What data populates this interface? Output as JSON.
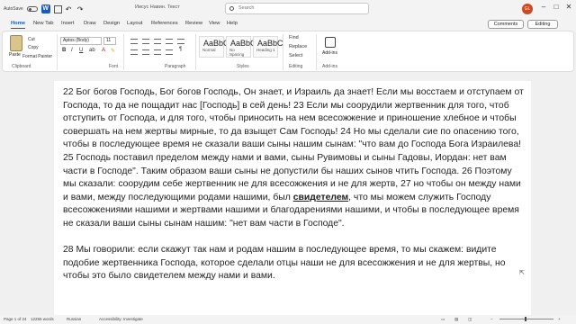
{
  "titlebar": {
    "autosave_label": "AutoSave",
    "doc_title": "Иисус Навин. Текст",
    "search_placeholder": "Search",
    "avatar_initials": "GL",
    "minimize": "–",
    "maximize": "□",
    "close": "✕"
  },
  "menu": {
    "tabs": [
      "Home",
      "New Tab",
      "Insert",
      "Draw",
      "Design",
      "Layout",
      "References",
      "Review",
      "View",
      "Help"
    ],
    "comments_label": "Comments",
    "editing_label": "Editing"
  },
  "ribbon": {
    "clipboard": {
      "paste": "Paste",
      "cut": "Cut",
      "copy": "Copy",
      "format_painter": "Format Painter",
      "group": "Clipboard"
    },
    "font": {
      "name": "Aptos (Body)",
      "size": "11",
      "group": "Font"
    },
    "paragraph": {
      "group": "Paragraph"
    },
    "styles": {
      "cards": [
        {
          "sample": "AaBbCcDc",
          "name": "Normal"
        },
        {
          "sample": "AaBbCcDc",
          "name": "No Spacing"
        },
        {
          "sample": "AaBbC",
          "name": "Heading 1"
        }
      ],
      "group": "Styles"
    },
    "editing": {
      "find": "Find",
      "replace": "Replace",
      "select": "Select",
      "group": "Editing"
    },
    "addins": {
      "label": "Add-ins",
      "group": "Add-ins"
    }
  },
  "document": {
    "para1_a": "22 Бог богов Господь, Бог богов Господь, Он знает, и Израиль да знает! Если мы восстаем и отступаем от Господа, то да не пощадит нас [Господь] в сей день!  23 Если мы соорудили жертвенник для того, чтоб отступить от Господа, и для того, чтобы приносить на нем всесожжение и приношение хлебное и чтобы совершать на нем жертвы мирные, то да взыщет Сам Господь!  24 Но мы сделали сие по опасению того, чтобы в последующее время не сказали ваши сыны нашим сынам: \"что вам до Господа Бога Израилева!  25 Господь поставил пределом между нами и вами, сыны Рувимовы и сыны Гадовы, Иордан: нет вам части в Господе\". Таким образом ваши сыны не допустили бы наших сынов чтить Господа.  26 Поэтому мы сказали: соорудим себе жертвенник не для всесожжения и не для жертв, 27 но чтобы он между нами и вами, между последующими родами нашими, был ",
    "para1_bold": "свидетелем",
    "para1_b": ", что мы можем служить Господу всесожжениями нашими и жертвами нашими и благодарениями нашими, и чтобы в последующее время не сказали ваши сыны сынам нашим: \"нет вам части в Господе\".",
    "para2": "28 Мы говорили: если скажут так нам и родам нашим в последующее время, то мы скажем: видите подобие жертвенника Господа, которое сделали отцы наши не для всесожжения и не для жертвы, но чтобы это было свидетелем между нами и вами."
  },
  "statusbar": {
    "page": "Page 1 of 24",
    "words": "12255 words",
    "language": "Russian",
    "accessibility": "Accessibility: Investigate"
  }
}
